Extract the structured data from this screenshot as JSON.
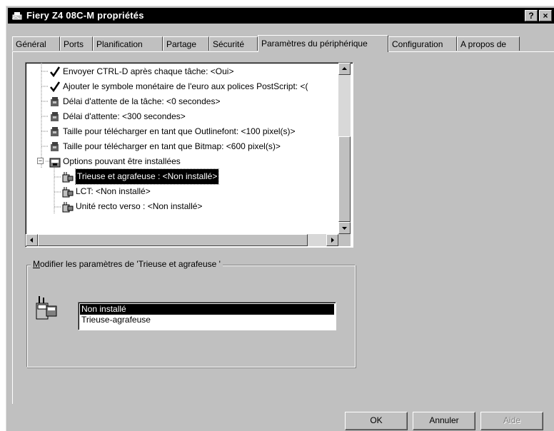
{
  "window": {
    "title": "Fiery Z4 08C-M propriétés",
    "help_glyph": "?",
    "close_glyph": "×"
  },
  "tabs": [
    {
      "label": "Général"
    },
    {
      "label": "Ports"
    },
    {
      "label": "Planification"
    },
    {
      "label": "Partage"
    },
    {
      "label": "Sécurité"
    },
    {
      "label": "Paramètres du périphérique"
    },
    {
      "label": "Configuration"
    },
    {
      "label": "A propos de"
    }
  ],
  "tree": {
    "items": [
      {
        "label": "Envoyer CTRL-D après chaque tâche: <Oui>",
        "icon": "checkmark-icon"
      },
      {
        "label": "Ajouter le symbole monétaire de l'euro aux polices PostScript: <(",
        "icon": "checkmark-icon"
      },
      {
        "label": "Délai d'attente de la tâche: <0 secondes>",
        "icon": "settings-icon"
      },
      {
        "label": "Délai d'attente: <300 secondes>",
        "icon": "settings-icon"
      },
      {
        "label": "Taille pour télécharger en tant que Outlinefont: <100 pixel(s)>",
        "icon": "settings-icon"
      },
      {
        "label": "Taille pour télécharger en tant que Bitmap: <600 pixel(s)>",
        "icon": "settings-icon"
      },
      {
        "label": "Options pouvant être installées",
        "icon": "printer-options-icon"
      },
      {
        "label": "Trieuse et agrafeuse : <Non installé>",
        "icon": "device-option-icon",
        "selected": true
      },
      {
        "label": "LCT: <Non installé>",
        "icon": "device-option-icon"
      },
      {
        "label": "Unité recto verso : <Non installé>",
        "icon": "device-option-icon"
      }
    ],
    "expander_glyph": "−"
  },
  "group": {
    "label": "Modifier les paramètres de 'Trieuse et agrafeuse '",
    "mnemonic": "M",
    "label_rest": "odifier les paramètres de 'Trieuse et agrafeuse '"
  },
  "options_list": {
    "items": [
      "Non installé",
      "Trieuse-agrafeuse"
    ],
    "selected": "Non installé"
  },
  "buttons": {
    "ok": "OK",
    "cancel": "Annuler",
    "help": "Aide"
  }
}
